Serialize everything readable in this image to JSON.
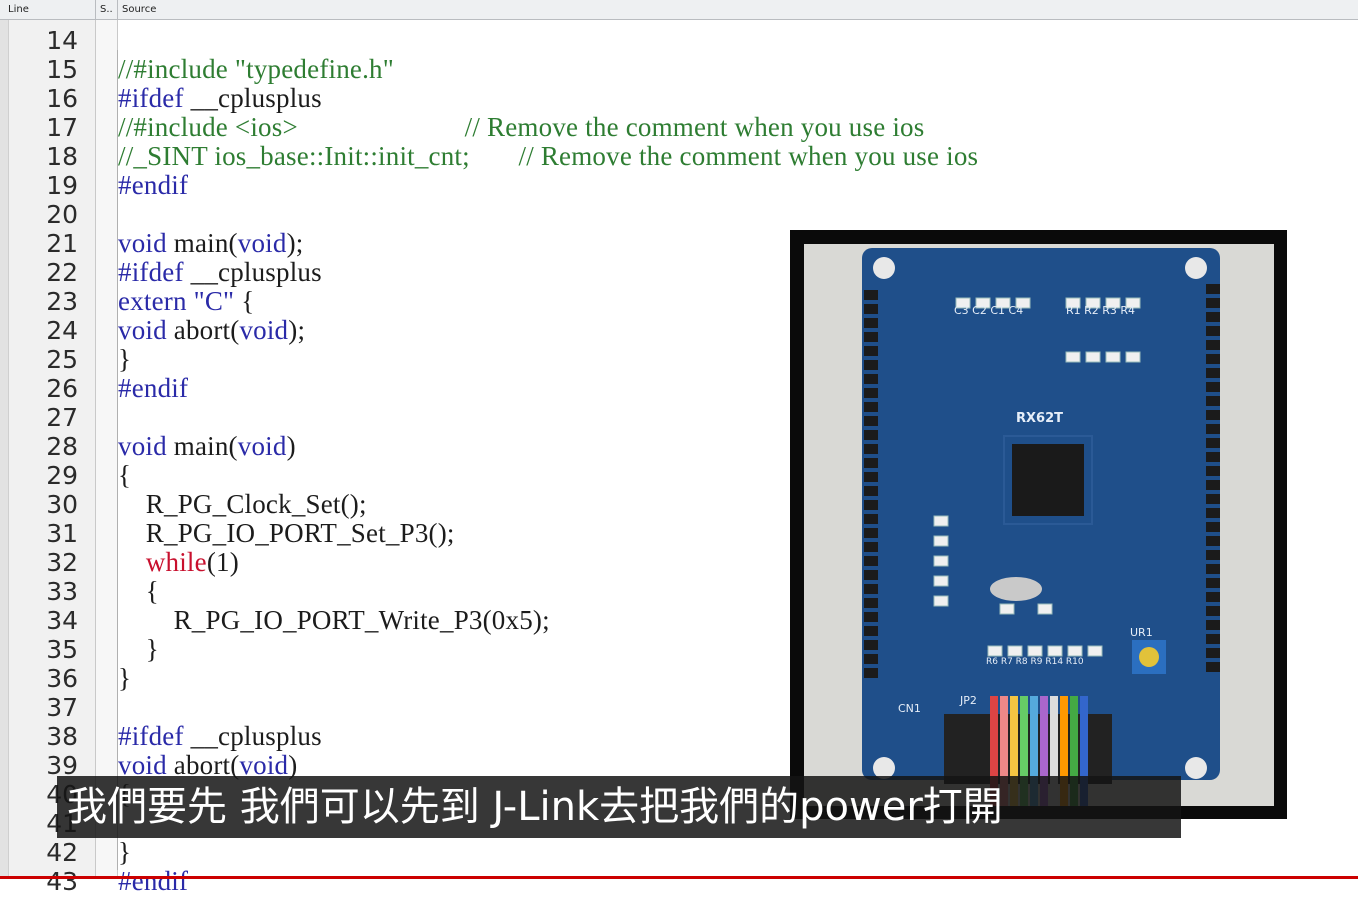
{
  "header": {
    "line_col": "Line",
    "s_col": "S..",
    "source_col": "Source"
  },
  "lines": [
    {
      "n": "14",
      "t": []
    },
    {
      "n": "15",
      "t": [
        {
          "c": "cm",
          "v": "//#include \"typedefine.h\""
        }
      ]
    },
    {
      "n": "16",
      "t": [
        {
          "c": "kw",
          "v": "#ifdef"
        },
        {
          "c": "",
          "v": " __cplusplus"
        }
      ]
    },
    {
      "n": "17",
      "t": [
        {
          "c": "cm",
          "v": "//#include <ios>                        // Remove the comment when you use ios"
        }
      ]
    },
    {
      "n": "18",
      "t": [
        {
          "c": "cm",
          "v": "//_SINT ios_base::Init::init_cnt;       // Remove the comment when you use ios"
        }
      ]
    },
    {
      "n": "19",
      "t": [
        {
          "c": "kw",
          "v": "#endif"
        }
      ]
    },
    {
      "n": "20",
      "t": []
    },
    {
      "n": "21",
      "t": [
        {
          "c": "kw",
          "v": "void"
        },
        {
          "c": "",
          "v": " main("
        },
        {
          "c": "kw",
          "v": "void"
        },
        {
          "c": "",
          "v": ");"
        }
      ]
    },
    {
      "n": "22",
      "t": [
        {
          "c": "kw",
          "v": "#ifdef"
        },
        {
          "c": "",
          "v": " __cplusplus"
        }
      ]
    },
    {
      "n": "23",
      "t": [
        {
          "c": "kw",
          "v": "extern"
        },
        {
          "c": "",
          "v": " "
        },
        {
          "c": "kw",
          "v": "\"C\""
        },
        {
          "c": "",
          "v": " {"
        }
      ]
    },
    {
      "n": "24",
      "t": [
        {
          "c": "kw",
          "v": "void"
        },
        {
          "c": "",
          "v": " abort("
        },
        {
          "c": "kw",
          "v": "void"
        },
        {
          "c": "",
          "v": ");"
        }
      ]
    },
    {
      "n": "25",
      "t": [
        {
          "c": "",
          "v": "}"
        }
      ]
    },
    {
      "n": "26",
      "t": [
        {
          "c": "kw",
          "v": "#endif"
        }
      ]
    },
    {
      "n": "27",
      "t": []
    },
    {
      "n": "28",
      "t": [
        {
          "c": "kw",
          "v": "void"
        },
        {
          "c": "",
          "v": " main("
        },
        {
          "c": "kw",
          "v": "void"
        },
        {
          "c": "",
          "v": ")"
        }
      ]
    },
    {
      "n": "29",
      "t": [
        {
          "c": "",
          "v": "{"
        }
      ]
    },
    {
      "n": "30",
      "t": [
        {
          "c": "",
          "v": "    R_PG_Clock_Set();"
        }
      ]
    },
    {
      "n": "31",
      "t": [
        {
          "c": "",
          "v": "    R_PG_IO_PORT_Set_P3();"
        }
      ]
    },
    {
      "n": "32",
      "t": [
        {
          "c": "",
          "v": "    "
        },
        {
          "c": "rd",
          "v": "while"
        },
        {
          "c": "",
          "v": "(1)"
        }
      ]
    },
    {
      "n": "33",
      "t": [
        {
          "c": "",
          "v": "    {"
        }
      ]
    },
    {
      "n": "34",
      "t": [
        {
          "c": "",
          "v": "        R_PG_IO_PORT_Write_P3(0x5);"
        }
      ]
    },
    {
      "n": "35",
      "t": [
        {
          "c": "",
          "v": "    }"
        }
      ]
    },
    {
      "n": "36",
      "t": [
        {
          "c": "",
          "v": "}"
        }
      ]
    },
    {
      "n": "37",
      "t": []
    },
    {
      "n": "38",
      "t": [
        {
          "c": "kw",
          "v": "#ifdef"
        },
        {
          "c": "",
          "v": " __cplusplus"
        }
      ]
    },
    {
      "n": "39",
      "t": [
        {
          "c": "kw",
          "v": "void"
        },
        {
          "c": "",
          "v": " abort("
        },
        {
          "c": "kw",
          "v": "void"
        },
        {
          "c": "",
          "v": ")"
        }
      ]
    },
    {
      "n": "40",
      "t": [
        {
          "c": "",
          "v": "{"
        }
      ]
    },
    {
      "n": "41",
      "t": []
    },
    {
      "n": "42",
      "t": [
        {
          "c": "",
          "v": "}"
        }
      ]
    },
    {
      "n": "43",
      "t": [
        {
          "c": "kw",
          "v": "#endif"
        }
      ]
    }
  ],
  "board": {
    "chip_label": "RX62T",
    "cap_labels": "C3 C2 C1 C4",
    "res_labels": "R1 R2 R3 R4",
    "res_row": "R6 R7 R8 R9 R14 R10",
    "conn_label": "CN1",
    "jp_label": "JP2",
    "ur_label": "UR1",
    "colors": {
      "pcb": "#1f4f8a",
      "pcb_dark": "#163d6b",
      "chip": "#1a1a1a"
    }
  },
  "subtitle": "我們要先 我們可以先到 J-Link去把我們的power打開"
}
